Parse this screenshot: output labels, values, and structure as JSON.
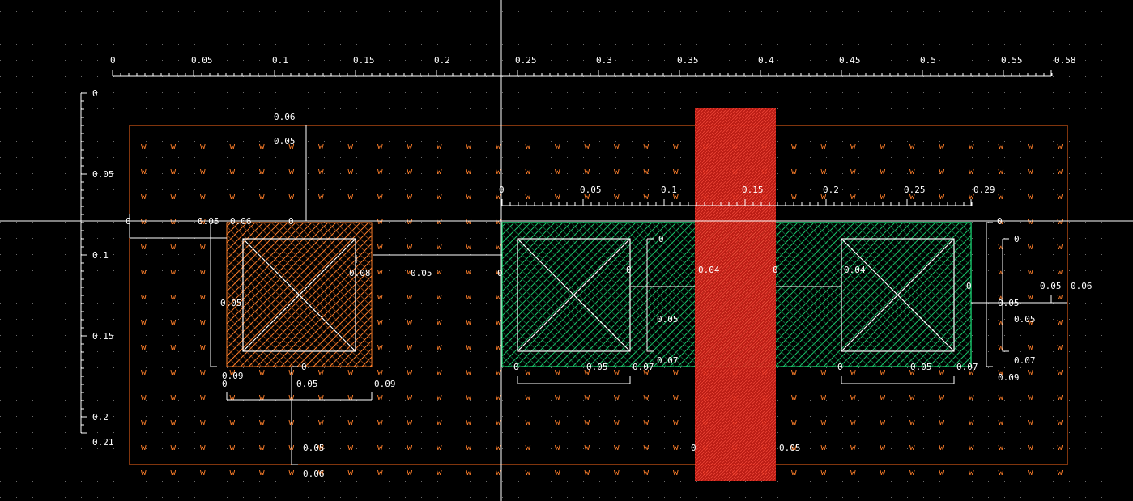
{
  "colors": {
    "background": "#000000",
    "well_outline": "#ff6a1a",
    "well_w": "#ff7f2a",
    "diff_p": "#ff7f2a",
    "diff_n": "#19c46a",
    "poly": "#e0231c",
    "contact": "#ffffff",
    "grid": "#6a6a6a"
  },
  "top_ruler": {
    "labels": [
      "0",
      "0.05",
      "0.1",
      "0.15",
      "0.2",
      "0.25",
      "0.3",
      "0.35",
      "0.4",
      "0.45",
      "0.5",
      "0.55",
      "0.58"
    ]
  },
  "left_ruler": {
    "labels": [
      "0",
      "0.05",
      "0.1",
      "0.15",
      "0.2",
      "0.21"
    ]
  },
  "inner_ruler": {
    "labels": [
      "0",
      "0.05",
      "0.1",
      "0.15",
      "0.2",
      "0.25",
      "0.29"
    ]
  },
  "dimensions": {
    "well_top_a": "0.06",
    "well_top_b": "0.05",
    "pdiff_left_0": "0",
    "pdiff_left_a": "0.05",
    "pdiff_left_b": "0.06",
    "pdiff_top_0": "0",
    "pdiff_right_08": "0.08",
    "pdiff_gap": "0.05",
    "pdiff_contact_0": "0",
    "pdiff_v_05": "0.05",
    "pdiff_bottom_09": "0.09",
    "pdiff_bottom_0": "0",
    "pdiff_h_0": "0",
    "pdiff_h_05": "0.05",
    "pdiff_h_09": "0.09",
    "ndiff_c1_0": "0",
    "ndiff_c1_v0": "0",
    "ndiff_c1_v05": "0.05",
    "ndiff_c1_v07": "0.07",
    "ndiff_c1_h0": "0",
    "ndiff_c1_h05": "0.05",
    "ndiff_c1_h07": "0.07",
    "ndiff_gap_0": "0",
    "ndiff_gap_04a": "0.04",
    "ndiff_gap_04b": "0.04",
    "ndiff_c2_0": "0",
    "ndiff_c2_h0": "0",
    "ndiff_c2_h05": "0.05",
    "ndiff_c2_h07": "0.07",
    "right_0": "0",
    "right_v0": "0",
    "right_v05a": "0.05",
    "right_v05b": "0.05",
    "right_v07": "0.07",
    "right_09": "0.09",
    "right_05": "0.05",
    "right_06": "0.06",
    "bottom_0": "0",
    "bottom_05a": "0.05",
    "bottom_06": "0.06",
    "bottom_05b": "0.05",
    "bottom_poly_0": "0"
  },
  "well_marker": "w"
}
